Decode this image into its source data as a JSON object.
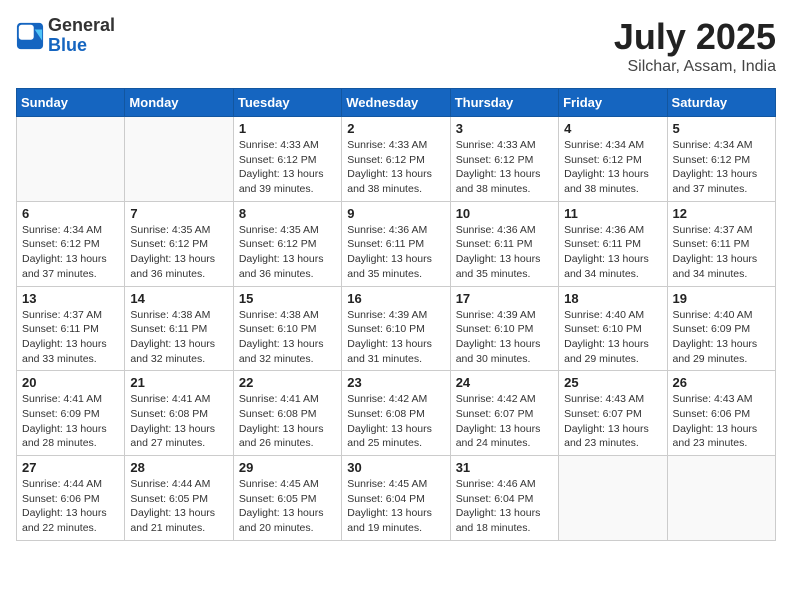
{
  "header": {
    "logo_general": "General",
    "logo_blue": "Blue",
    "month": "July 2025",
    "location": "Silchar, Assam, India"
  },
  "days_of_week": [
    "Sunday",
    "Monday",
    "Tuesday",
    "Wednesday",
    "Thursday",
    "Friday",
    "Saturday"
  ],
  "weeks": [
    [
      {
        "num": "",
        "info": ""
      },
      {
        "num": "",
        "info": ""
      },
      {
        "num": "1",
        "info": "Sunrise: 4:33 AM\nSunset: 6:12 PM\nDaylight: 13 hours and 39 minutes."
      },
      {
        "num": "2",
        "info": "Sunrise: 4:33 AM\nSunset: 6:12 PM\nDaylight: 13 hours and 38 minutes."
      },
      {
        "num": "3",
        "info": "Sunrise: 4:33 AM\nSunset: 6:12 PM\nDaylight: 13 hours and 38 minutes."
      },
      {
        "num": "4",
        "info": "Sunrise: 4:34 AM\nSunset: 6:12 PM\nDaylight: 13 hours and 38 minutes."
      },
      {
        "num": "5",
        "info": "Sunrise: 4:34 AM\nSunset: 6:12 PM\nDaylight: 13 hours and 37 minutes."
      }
    ],
    [
      {
        "num": "6",
        "info": "Sunrise: 4:34 AM\nSunset: 6:12 PM\nDaylight: 13 hours and 37 minutes."
      },
      {
        "num": "7",
        "info": "Sunrise: 4:35 AM\nSunset: 6:12 PM\nDaylight: 13 hours and 36 minutes."
      },
      {
        "num": "8",
        "info": "Sunrise: 4:35 AM\nSunset: 6:12 PM\nDaylight: 13 hours and 36 minutes."
      },
      {
        "num": "9",
        "info": "Sunrise: 4:36 AM\nSunset: 6:11 PM\nDaylight: 13 hours and 35 minutes."
      },
      {
        "num": "10",
        "info": "Sunrise: 4:36 AM\nSunset: 6:11 PM\nDaylight: 13 hours and 35 minutes."
      },
      {
        "num": "11",
        "info": "Sunrise: 4:36 AM\nSunset: 6:11 PM\nDaylight: 13 hours and 34 minutes."
      },
      {
        "num": "12",
        "info": "Sunrise: 4:37 AM\nSunset: 6:11 PM\nDaylight: 13 hours and 34 minutes."
      }
    ],
    [
      {
        "num": "13",
        "info": "Sunrise: 4:37 AM\nSunset: 6:11 PM\nDaylight: 13 hours and 33 minutes."
      },
      {
        "num": "14",
        "info": "Sunrise: 4:38 AM\nSunset: 6:11 PM\nDaylight: 13 hours and 32 minutes."
      },
      {
        "num": "15",
        "info": "Sunrise: 4:38 AM\nSunset: 6:10 PM\nDaylight: 13 hours and 32 minutes."
      },
      {
        "num": "16",
        "info": "Sunrise: 4:39 AM\nSunset: 6:10 PM\nDaylight: 13 hours and 31 minutes."
      },
      {
        "num": "17",
        "info": "Sunrise: 4:39 AM\nSunset: 6:10 PM\nDaylight: 13 hours and 30 minutes."
      },
      {
        "num": "18",
        "info": "Sunrise: 4:40 AM\nSunset: 6:10 PM\nDaylight: 13 hours and 29 minutes."
      },
      {
        "num": "19",
        "info": "Sunrise: 4:40 AM\nSunset: 6:09 PM\nDaylight: 13 hours and 29 minutes."
      }
    ],
    [
      {
        "num": "20",
        "info": "Sunrise: 4:41 AM\nSunset: 6:09 PM\nDaylight: 13 hours and 28 minutes."
      },
      {
        "num": "21",
        "info": "Sunrise: 4:41 AM\nSunset: 6:08 PM\nDaylight: 13 hours and 27 minutes."
      },
      {
        "num": "22",
        "info": "Sunrise: 4:41 AM\nSunset: 6:08 PM\nDaylight: 13 hours and 26 minutes."
      },
      {
        "num": "23",
        "info": "Sunrise: 4:42 AM\nSunset: 6:08 PM\nDaylight: 13 hours and 25 minutes."
      },
      {
        "num": "24",
        "info": "Sunrise: 4:42 AM\nSunset: 6:07 PM\nDaylight: 13 hours and 24 minutes."
      },
      {
        "num": "25",
        "info": "Sunrise: 4:43 AM\nSunset: 6:07 PM\nDaylight: 13 hours and 23 minutes."
      },
      {
        "num": "26",
        "info": "Sunrise: 4:43 AM\nSunset: 6:06 PM\nDaylight: 13 hours and 23 minutes."
      }
    ],
    [
      {
        "num": "27",
        "info": "Sunrise: 4:44 AM\nSunset: 6:06 PM\nDaylight: 13 hours and 22 minutes."
      },
      {
        "num": "28",
        "info": "Sunrise: 4:44 AM\nSunset: 6:05 PM\nDaylight: 13 hours and 21 minutes."
      },
      {
        "num": "29",
        "info": "Sunrise: 4:45 AM\nSunset: 6:05 PM\nDaylight: 13 hours and 20 minutes."
      },
      {
        "num": "30",
        "info": "Sunrise: 4:45 AM\nSunset: 6:04 PM\nDaylight: 13 hours and 19 minutes."
      },
      {
        "num": "31",
        "info": "Sunrise: 4:46 AM\nSunset: 6:04 PM\nDaylight: 13 hours and 18 minutes."
      },
      {
        "num": "",
        "info": ""
      },
      {
        "num": "",
        "info": ""
      }
    ]
  ]
}
